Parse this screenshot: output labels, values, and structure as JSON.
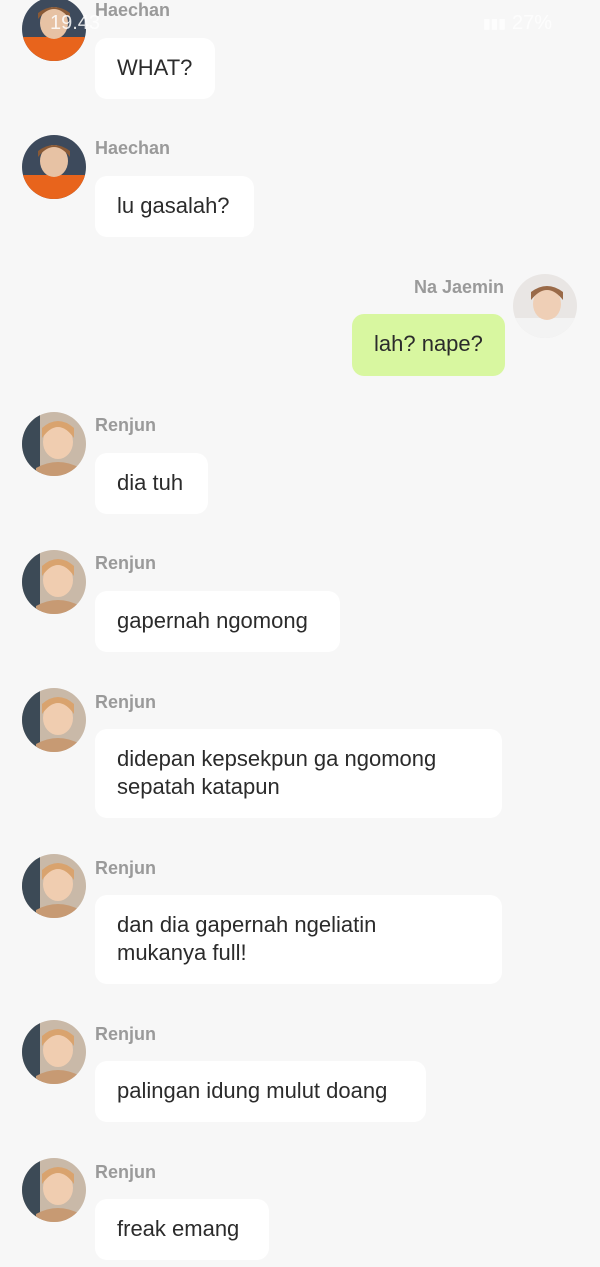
{
  "status_bar": {
    "time": "19.43",
    "battery": "27%"
  },
  "messages": [
    {
      "sender": "Haechan",
      "lines": [
        "WHAT?"
      ],
      "own": false,
      "avatar": "haechan-avatar"
    },
    {
      "sender": "Haechan",
      "lines": [
        "lu gasalah?"
      ],
      "own": false,
      "avatar": "haechan-avatar"
    },
    {
      "sender": "Na Jaemin",
      "lines": [
        "lah? nape?"
      ],
      "own": true,
      "avatar": "jaemin-avatar"
    },
    {
      "sender": "Renjun",
      "lines": [
        "dia tuh"
      ],
      "own": false,
      "avatar": "renjun-avatar"
    },
    {
      "sender": "Renjun",
      "lines": [
        "gapernah ngomong"
      ],
      "own": false,
      "avatar": "renjun-avatar"
    },
    {
      "sender": "Renjun",
      "lines": [
        "didepan kepsekpun ga ngomong",
        "sepatah katapun"
      ],
      "own": false,
      "avatar": "renjun-avatar"
    },
    {
      "sender": "Renjun",
      "lines": [
        "dan dia gapernah ngeliatin",
        "mukanya full!"
      ],
      "own": false,
      "avatar": "renjun-avatar"
    },
    {
      "sender": "Renjun",
      "lines": [
        "palingan idung mulut doang"
      ],
      "own": false,
      "avatar": "renjun-avatar"
    },
    {
      "sender": "Renjun",
      "lines": [
        "freak emang"
      ],
      "own": false,
      "avatar": "renjun-avatar"
    }
  ]
}
